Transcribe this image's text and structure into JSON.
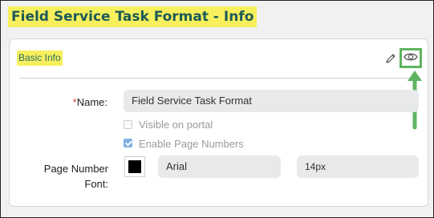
{
  "page": {
    "title": "Field Service Task Format - Info"
  },
  "card": {
    "title": "Basic Info",
    "actions": {
      "edit_icon": "pencil-icon",
      "view_icon": "eye-icon"
    }
  },
  "form": {
    "name": {
      "required_mark": "*",
      "label": "Name:",
      "value": "Field Service Task Format"
    },
    "visible_on_portal": {
      "label": "Visible on portal",
      "checked": false
    },
    "enable_page_numbers": {
      "label": "Enable Page Numbers",
      "checked": true
    },
    "page_number_font": {
      "label_line1": "Page Number",
      "label_line2": "Font:",
      "color": "#000000",
      "family": "Arial",
      "size": "14px"
    }
  },
  "colors": {
    "highlight": "#f7f05c",
    "title_text": "#1d5a56",
    "annotation_green": "#5fb55f",
    "checkbox_checked": "#7fb1e3"
  }
}
